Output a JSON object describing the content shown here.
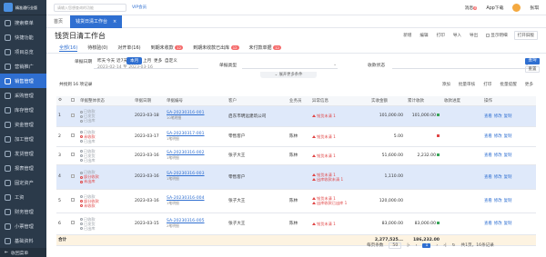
{
  "app": {
    "logo_text": "精准通行业版",
    "footer_label": "收回菜单"
  },
  "sidebar": {
    "items": [
      {
        "label": "搜索菜单"
      },
      {
        "label": "快捷功能"
      },
      {
        "label": "项目总览"
      },
      {
        "label": "营销推广"
      },
      {
        "label": "销售管理"
      },
      {
        "label": "采购管理"
      },
      {
        "label": "库存管理"
      },
      {
        "label": "资金管理"
      },
      {
        "label": "加工管理"
      },
      {
        "label": "发货管理"
      },
      {
        "label": "报表管理"
      },
      {
        "label": "固定资产"
      },
      {
        "label": "工资"
      },
      {
        "label": "财务管理"
      },
      {
        "label": "小票管理"
      },
      {
        "label": "基础资料"
      }
    ]
  },
  "topbar": {
    "search_placeholder": "请输入您想查询的功能",
    "vip": "VIP会员",
    "msg": "消息",
    "msg_count": "8",
    "app_download": "App下载",
    "user": "张琪"
  },
  "tabs": {
    "home": "首页",
    "active": "钱货日清工作台"
  },
  "page": {
    "title": "钱货日清工作台",
    "actions": [
      "新增",
      "编辑",
      "打印",
      "导入",
      "导出",
      "显示明细",
      "打开旧版"
    ]
  },
  "status_tabs": [
    {
      "label": "全部(16)",
      "count": ""
    },
    {
      "label": "待核验(0)",
      "count": ""
    },
    {
      "label": "对开单(16)",
      "count": ""
    },
    {
      "label": "到期未收款",
      "count": "12"
    },
    {
      "label": "到期未收款已出库",
      "count": "12"
    },
    {
      "label": "未付款单据",
      "count": "12"
    }
  ],
  "filters": {
    "date_label": "单据日期",
    "quick": [
      "昨天",
      "今天",
      "近7天",
      "本月",
      "上月",
      "更多",
      "自定义"
    ],
    "date_range": "2023-02-14 至 2023-03-16",
    "type_label": "单据类型",
    "client_label": "收款状态",
    "query": "查询",
    "reset": "重置",
    "expand": "展开更多条件"
  },
  "toolbar": {
    "count": "共找到 16 项记录",
    "tools": [
      "添加",
      "批量审核",
      "打印",
      "批量提醒",
      "更多"
    ]
  },
  "table": {
    "headers": [
      "",
      "",
      "单据整体状态",
      "单据日期",
      "单据编号",
      "客户",
      "业务员",
      "异常信息",
      "实收金额",
      "累计收款",
      "收款进度",
      "操作"
    ],
    "rows": [
      {
        "no": "1",
        "status": [
          {
            "t": "已收款",
            "c": "gray"
          },
          {
            "t": "已发货",
            "c": "gray"
          },
          {
            "t": "已出库",
            "c": "gray"
          }
        ],
        "date": "2023-03-18",
        "code": "SA-20230316-001",
        "sub": "10笔明细",
        "client": "启东市明远建筑公司",
        "staff": "",
        "warn": [
          "钱货未清 1"
        ],
        "amount": "101,000.00",
        "total": "101,000.00",
        "bar": "#3aa55a",
        "ops": [
          "查看",
          "修改",
          "复制"
        ]
      },
      {
        "no": "2",
        "status": [
          {
            "t": "已收款",
            "c": "gray"
          },
          {
            "t": "未收款",
            "c": "red"
          },
          {
            "t": "已出库",
            "c": "gray"
          }
        ],
        "date": "2023-03-17",
        "code": "SA-20230317-001",
        "sub": "1笔明细",
        "client": "零售客户",
        "staff": "陈林",
        "warn": [
          "钱货未清 1"
        ],
        "amount": "5.00",
        "total": "",
        "bar": "#e04545",
        "ops": [
          "查看",
          "修改",
          "复制"
        ]
      },
      {
        "no": "3",
        "status": [
          {
            "t": "已收款",
            "c": "gray"
          },
          {
            "t": "已发货",
            "c": "gray"
          },
          {
            "t": "已出库",
            "c": "gray"
          }
        ],
        "date": "2023-03-16",
        "code": "SA-20230316-002",
        "sub": "1笔明细",
        "client": "张子大王",
        "staff": "陈林",
        "warn": [
          "钱货未清 1"
        ],
        "amount": "51,600.00",
        "total": "2,232.00",
        "bar": "#3aa55a",
        "ops": [
          "查看",
          "修改",
          "复制"
        ]
      },
      {
        "no": "4",
        "status": [
          {
            "t": "已收款",
            "c": "gray"
          },
          {
            "t": "部分收款",
            "c": "red"
          },
          {
            "t": "未出库",
            "c": "red"
          }
        ],
        "date": "2023-03-16",
        "code": "SA-20230316-003",
        "sub": "1笔明细",
        "client": "零售客户",
        "staff": "",
        "warn": [
          "钱货未清 1",
          "出库收款未清 1"
        ],
        "amount": "1,110.00",
        "total": "",
        "bar": "",
        "ops": [
          "查看",
          "修改",
          "复制"
        ]
      },
      {
        "no": "5",
        "status": [
          {
            "t": "已收款",
            "c": "gray"
          },
          {
            "t": "部分收款",
            "c": "red"
          },
          {
            "t": "未收款",
            "c": "red"
          }
        ],
        "date": "2023-03-16",
        "code": "SA-20230316-004",
        "sub": "1笔明细",
        "client": "张子大王",
        "staff": "陈林",
        "warn": [
          "钱货未清 1",
          "出库收款已出库 1"
        ],
        "amount": "120,000.00",
        "total": "",
        "bar": "",
        "ops": [
          "查看",
          "修改",
          "复制"
        ]
      },
      {
        "no": "6",
        "status": [
          {
            "t": "已收款",
            "c": "gray"
          },
          {
            "t": "已发货",
            "c": "gray"
          },
          {
            "t": "已出库",
            "c": "gray"
          }
        ],
        "date": "2023-03-15",
        "code": "SA-20230316-005",
        "sub": "2笔明细",
        "client": "张子大王",
        "staff": "陈林",
        "warn": [
          "钱货未清 1"
        ],
        "amount": "83,000.00",
        "total": "83,000.00",
        "bar": "#3aa55a",
        "ops": [
          "查看",
          "修改",
          "复制"
        ]
      }
    ],
    "sum": {
      "label": "合计",
      "amount": "2,277,525...",
      "total": "186,232.00"
    }
  },
  "pager": {
    "size_label": "每页条数",
    "size": "50",
    "cur": "1",
    "total": "共1页，16条记录"
  },
  "colors": {
    "primary": "#2f6fd1",
    "sidebar": "#2b3a4a",
    "danger": "#e04545",
    "success": "#3aa55a",
    "sum_row": "#fdf3e1"
  }
}
